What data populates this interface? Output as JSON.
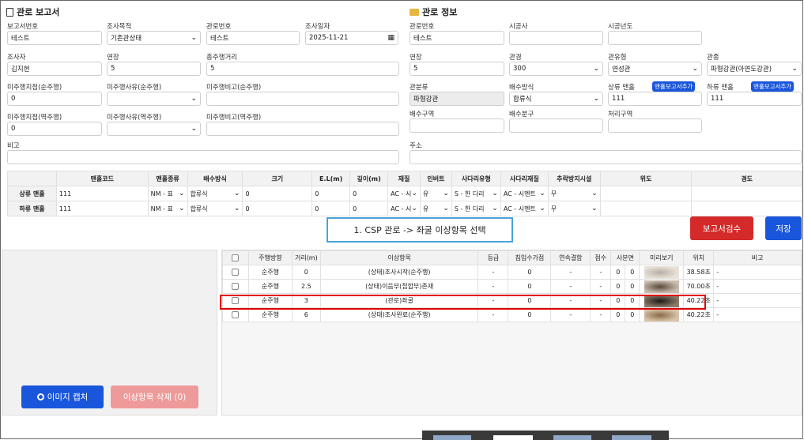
{
  "report": {
    "title": "관로 보고서",
    "fields": [
      {
        "label": "보고서번호",
        "value": "테스트"
      },
      {
        "label": "조사목적",
        "value": "기존관상태"
      },
      {
        "label": "관로번호",
        "value": "테스트"
      },
      {
        "label": "조사일자",
        "value": "2025-11-21"
      },
      {
        "label": "조사자",
        "value": "김지현"
      },
      {
        "label": "연장",
        "value": "5"
      },
      {
        "label": "총주행거리",
        "value": "5"
      },
      {
        "label": "미주행지점(순주행)",
        "value": "0"
      },
      {
        "label": "미주행사유(순주행)",
        "value": ""
      },
      {
        "label": "미주행비고(순주행)",
        "value": ""
      },
      {
        "label": "미주행지점(역주행)",
        "value": "0"
      },
      {
        "label": "미주행사유(역주행)",
        "value": ""
      },
      {
        "label": "미주행비고(역주행)",
        "value": ""
      },
      {
        "label": "비고",
        "value": ""
      }
    ]
  },
  "pipe": {
    "title": "관로 정보",
    "fields": [
      {
        "label": "관로번호",
        "value": "테스트"
      },
      {
        "label": "시공사",
        "value": ""
      },
      {
        "label": "시공년도",
        "value": ""
      },
      {
        "label": "연장",
        "value": "5"
      },
      {
        "label": "관경",
        "value": "300"
      },
      {
        "label": "관유형",
        "value": "연성관"
      },
      {
        "label": "관종",
        "value": "파형강관(아연도강관)"
      },
      {
        "label": "관분류",
        "value": "파형강관"
      },
      {
        "label": "배수방식",
        "value": "합류식"
      },
      {
        "label": "상류 맨홀",
        "value": "111"
      },
      {
        "label": "하류 맨홀",
        "value": "111"
      },
      {
        "label": "배수구역",
        "value": ""
      },
      {
        "label": "배수분구",
        "value": ""
      },
      {
        "label": "처리구역",
        "value": ""
      },
      {
        "label": "주소",
        "value": ""
      }
    ],
    "manhole_add_label": "맨홀보고서추가"
  },
  "manhole_table": {
    "headers": [
      "",
      "맨홀코드",
      "맨홀종류",
      "배수방식",
      "크기",
      "E.L(m)",
      "깊이(m)",
      "재질",
      "인버트",
      "사다리유형",
      "사다리재질",
      "추락방지시설",
      "위도",
      "경도"
    ],
    "rows": [
      [
        "상류 맨홀",
        "111",
        "NM - 표",
        "합류식",
        "0",
        "0",
        "0",
        "AC - 시",
        "유",
        "S - 한 다리",
        "AC - 시멘트",
        "무",
        "",
        ""
      ],
      [
        "하류 맨홀",
        "111",
        "NM - 표",
        "합류식",
        "0",
        "0",
        "0",
        "AC - 시",
        "유",
        "S - 한 다리",
        "AC - 시멘트",
        "무",
        "",
        ""
      ]
    ]
  },
  "annotation": "1. CSP 관로 -> 좌굴 이상항목 선택",
  "buttons": {
    "review": "보고서검수",
    "save": "저장",
    "capture": "이미지 캡처",
    "delete": "이상항목 삭제 (0)"
  },
  "abnormal_table": {
    "headers": [
      "",
      "주행방향",
      "거리(m)",
      "이상항목",
      "등급",
      "침입수가점",
      "연속결함",
      "점수",
      "사분면",
      "",
      "미리보기",
      "위치",
      "비고"
    ],
    "rows": [
      [
        "순주행",
        "0",
        "(상태)조사시작(순주행)",
        "-",
        "0",
        "-",
        "-",
        "0",
        "0",
        "38.58초",
        "-"
      ],
      [
        "순주행",
        "2.5",
        "(상태)이음부(접합부)존재",
        "-",
        "0",
        "-",
        "-",
        "0",
        "0",
        "70.00초",
        "-"
      ],
      [
        "순주행",
        "3",
        "(관로)좌굴",
        "-",
        "0",
        "-",
        "-",
        "0",
        "0",
        "40.22초",
        "-"
      ],
      [
        "순주행",
        "6",
        "(상태)조사완료(순주행)",
        "-",
        "0",
        "-",
        "-",
        "0",
        "0",
        "40.22초",
        "-"
      ]
    ]
  },
  "colors": {
    "primary": "#1a56db",
    "danger": "#d42a2a",
    "highlight": "#e00000",
    "callout_border": "#4aa3d6"
  }
}
